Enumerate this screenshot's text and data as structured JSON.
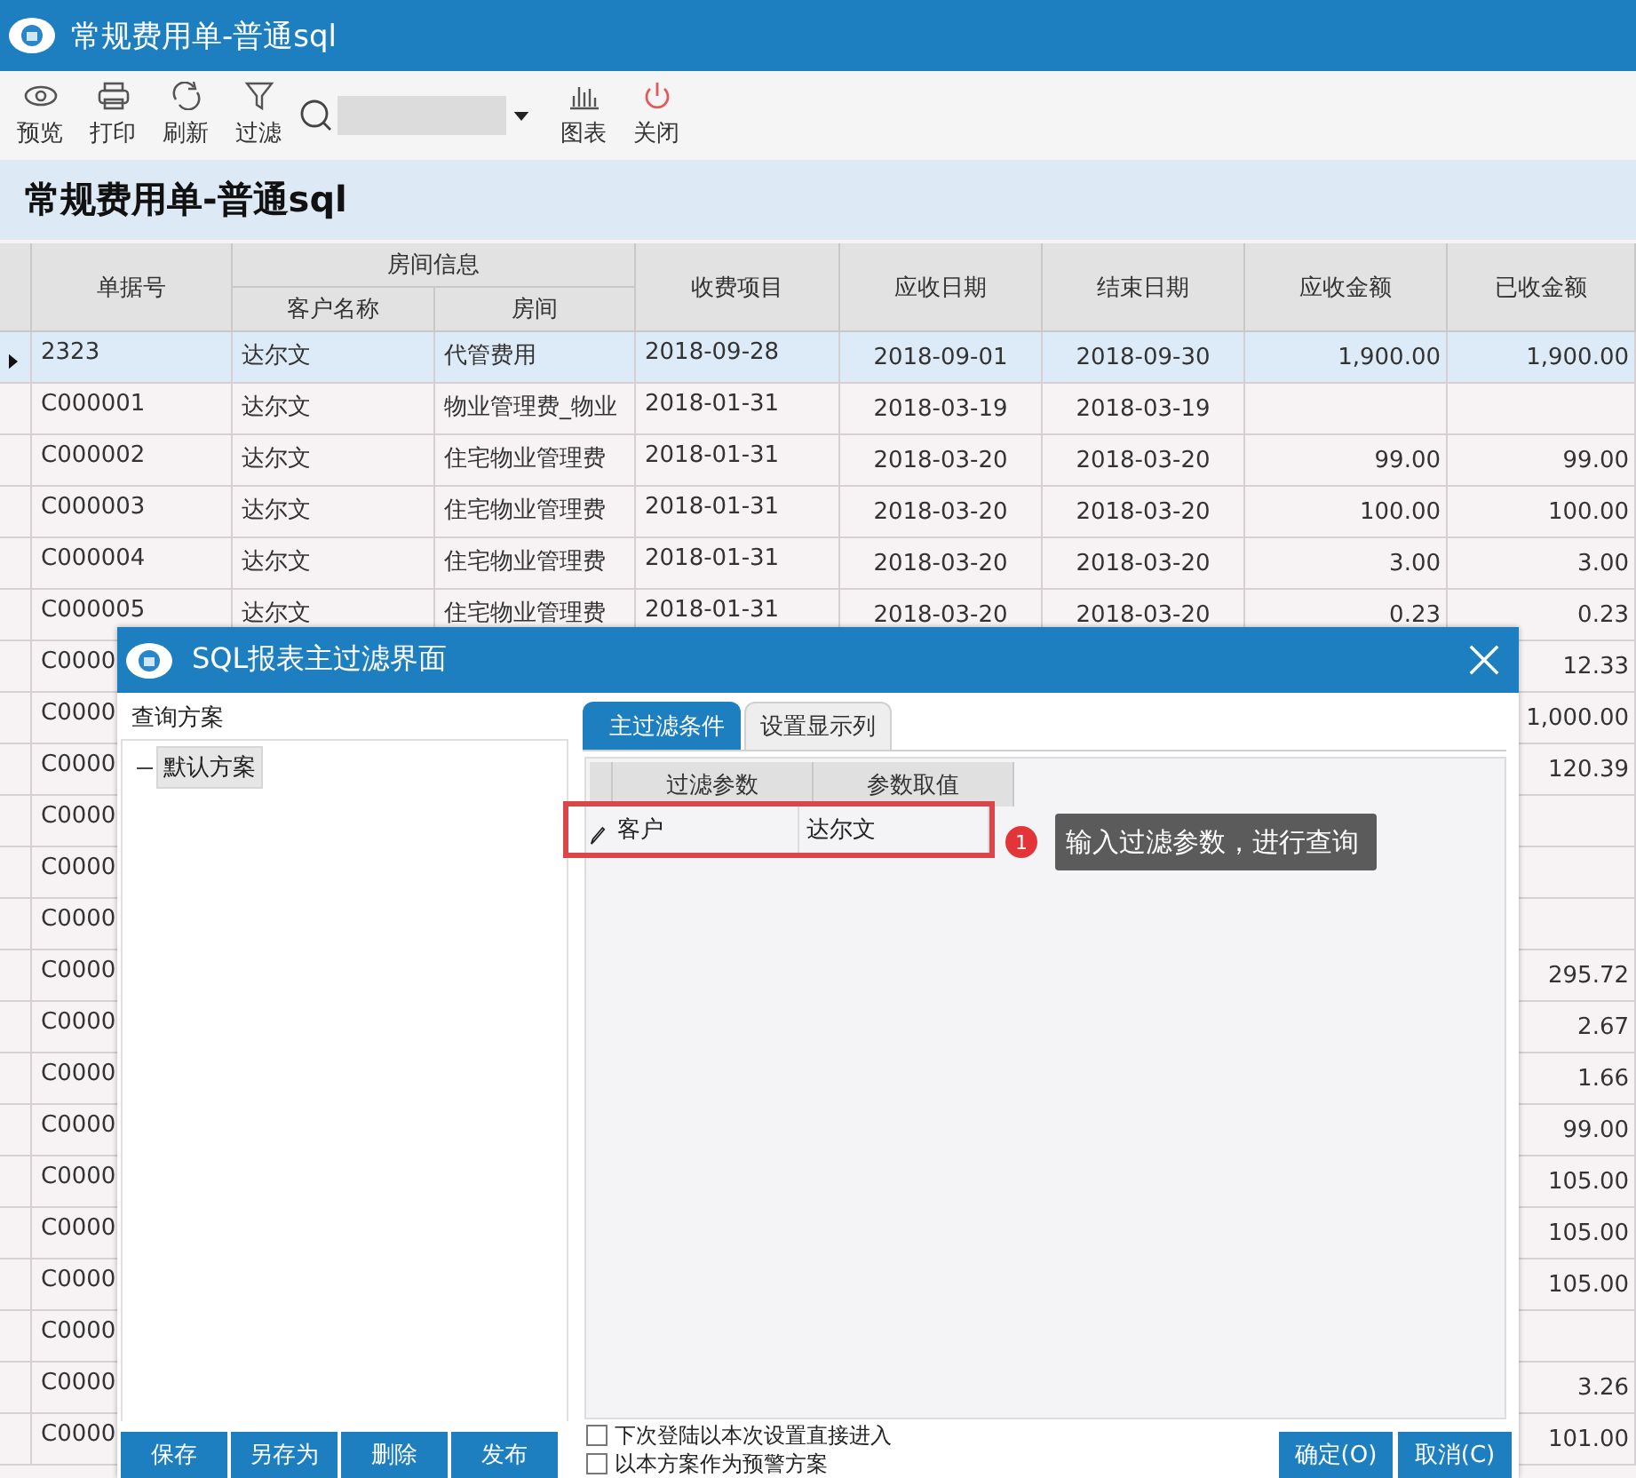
{
  "window": {
    "title": "常规费用单-普通sql"
  },
  "toolbar": {
    "buttons": [
      {
        "label": "预览"
      },
      {
        "label": "打印"
      },
      {
        "label": "刷新"
      },
      {
        "label": "过滤"
      }
    ],
    "chart_buttons": [
      {
        "label": "图表"
      },
      {
        "label": "关闭"
      }
    ]
  },
  "report_title": "常规费用单-普通sql",
  "table": {
    "group_label": "房间信息",
    "columns": [
      {
        "label": "单据号",
        "grouped": false
      },
      {
        "label": "客户名称",
        "grouped": true
      },
      {
        "label": "房间",
        "grouped": true
      },
      {
        "label": "收费项目",
        "grouped": false
      },
      {
        "label": "应收日期",
        "grouped": false
      },
      {
        "label": "结束日期",
        "grouped": false
      },
      {
        "label": "应收金额",
        "grouped": false
      },
      {
        "label": "已收金额",
        "grouped": false
      }
    ],
    "rows": [
      {
        "selected": true,
        "cells": [
          "2323",
          "达尔文",
          "代管费用",
          "2018-09-28",
          "2018-09-01",
          "2018-09-30",
          "1,900.00",
          "1,900.00"
        ]
      },
      {
        "selected": false,
        "cells": [
          "C000001",
          "达尔文",
          "物业管理费_物业",
          "2018-01-31",
          "2018-03-19",
          "2018-03-19",
          null,
          null
        ]
      },
      {
        "selected": false,
        "cells": [
          "C000002",
          "达尔文",
          "住宅物业管理费",
          "2018-01-31",
          "2018-03-20",
          "2018-03-20",
          "99.00",
          "99.00"
        ]
      },
      {
        "selected": false,
        "cells": [
          "C000003",
          "达尔文",
          "住宅物业管理费",
          "2018-01-31",
          "2018-03-20",
          "2018-03-20",
          "100.00",
          "100.00"
        ]
      },
      {
        "selected": false,
        "cells": [
          "C000004",
          "达尔文",
          "住宅物业管理费",
          "2018-01-31",
          "2018-03-20",
          "2018-03-20",
          "3.00",
          "3.00"
        ]
      },
      {
        "selected": false,
        "cells": [
          "C000005",
          "达尔文",
          "住宅物业管理费",
          "2018-01-31",
          "2018-03-20",
          "2018-03-20",
          "0.23",
          "0.23"
        ]
      },
      {
        "selected": false,
        "cells": [
          "C0000",
          null,
          null,
          null,
          null,
          null,
          null,
          "12.33"
        ]
      },
      {
        "selected": false,
        "cells": [
          "C0000",
          null,
          null,
          null,
          null,
          null,
          null,
          "1,000.00"
        ]
      },
      {
        "selected": false,
        "cells": [
          "C0000",
          null,
          null,
          null,
          null,
          null,
          null,
          "120.39"
        ]
      },
      {
        "selected": false,
        "cells": [
          "C0000",
          null,
          null,
          null,
          null,
          null,
          null,
          null
        ]
      },
      {
        "selected": false,
        "cells": [
          "C0000",
          null,
          null,
          null,
          null,
          null,
          null,
          null
        ]
      },
      {
        "selected": false,
        "cells": [
          "C0000",
          null,
          null,
          null,
          null,
          null,
          null,
          null
        ]
      },
      {
        "selected": false,
        "cells": [
          "C0000",
          null,
          null,
          null,
          null,
          null,
          null,
          "295.72"
        ]
      },
      {
        "selected": false,
        "cells": [
          "C0000",
          null,
          null,
          null,
          null,
          null,
          null,
          "2.67"
        ]
      },
      {
        "selected": false,
        "cells": [
          "C0000",
          null,
          null,
          null,
          null,
          null,
          null,
          "1.66"
        ]
      },
      {
        "selected": false,
        "cells": [
          "C0000",
          null,
          null,
          null,
          null,
          null,
          null,
          "99.00"
        ]
      },
      {
        "selected": false,
        "cells": [
          "C0000",
          null,
          null,
          null,
          null,
          null,
          null,
          "105.00"
        ]
      },
      {
        "selected": false,
        "cells": [
          "C0000",
          null,
          null,
          null,
          null,
          null,
          null,
          "105.00"
        ]
      },
      {
        "selected": false,
        "cells": [
          "C0000",
          null,
          null,
          null,
          null,
          null,
          null,
          "105.00"
        ]
      },
      {
        "selected": false,
        "cells": [
          "C0000",
          null,
          null,
          null,
          null,
          null,
          null,
          null
        ]
      },
      {
        "selected": false,
        "cells": [
          "C0000",
          null,
          null,
          null,
          null,
          null,
          null,
          "3.26"
        ]
      },
      {
        "selected": false,
        "cells": [
          "C0000",
          null,
          null,
          null,
          null,
          null,
          null,
          "101.00"
        ]
      }
    ]
  },
  "dialog": {
    "title": "SQL报表主过滤界面",
    "scheme_label": "查询方案",
    "schemes": [
      {
        "label": "默认方案",
        "selected": true
      }
    ],
    "tabs": [
      {
        "label": "主过滤条件",
        "selected": true
      },
      {
        "label": "设置显示列",
        "selected": false
      }
    ],
    "filter_table": {
      "columns": [
        "过滤参数",
        "参数取值"
      ],
      "rows": [
        {
          "param": "客户",
          "value": "达尔文",
          "editing": true,
          "highlighted": true
        }
      ]
    },
    "callout": {
      "number": "1",
      "text": "输入过滤参数，进行查询"
    },
    "scheme_buttons": [
      "保存",
      "另存为",
      "删除",
      "发布"
    ],
    "options": [
      {
        "label": "下次登陆以本次设置直接进入",
        "checked": false
      },
      {
        "label": "以本方案作为预警方案",
        "checked": false
      }
    ],
    "buttons": [
      "确定(O)",
      "取消(C)"
    ]
  }
}
